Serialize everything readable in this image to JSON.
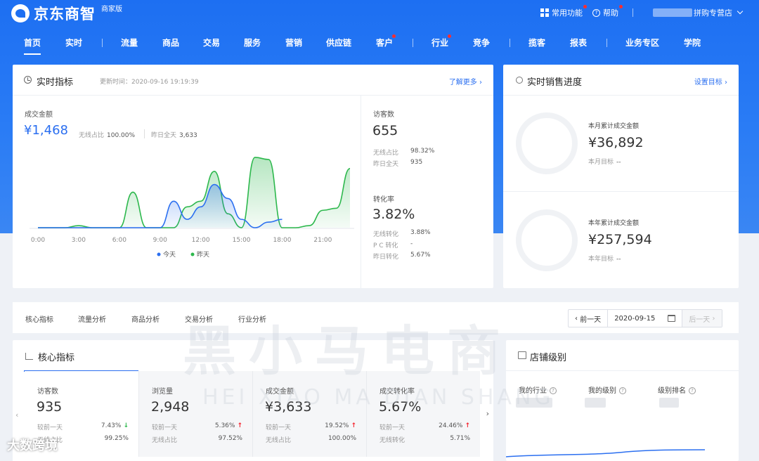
{
  "app": {
    "logo": "京东商智",
    "edition": "商家版"
  },
  "topbar": {
    "functions": "常用功能",
    "help": "帮助",
    "store": "拼购专营店"
  },
  "nav": [
    "首页",
    "实时",
    "流量",
    "商品",
    "交易",
    "服务",
    "营销",
    "供应链",
    "客户",
    "行业",
    "竞争",
    "揽客",
    "报表",
    "业务专区",
    "学院"
  ],
  "realtime": {
    "title": "实时指标",
    "update_time": "更新时间：2020-09-16 19:19:39",
    "more": "了解更多",
    "gmv_label": "成交金额",
    "gmv_value": "¥1,468",
    "wireless_label": "无线占比",
    "wireless_value": "100.00%",
    "yesterday_label": "昨日全天",
    "yesterday_value": "3,633",
    "visitors_label": "访客数",
    "visitors_value": "655",
    "v_wireless_label": "无线占比",
    "v_wireless_value": "98.32%",
    "v_yesterday_label": "昨日全天",
    "v_yesterday_value": "935",
    "conv_label": "转化率",
    "conv_value": "3.82%",
    "c_wireless_label": "无线转化",
    "c_wireless_value": "3.88%",
    "c_pc_label": "P C 转化",
    "c_pc_value": "-",
    "c_yesterday_label": "昨日转化",
    "c_yesterday_value": "5.67%"
  },
  "chart_data": {
    "type": "area",
    "x_ticks": [
      "0:00",
      "3:00",
      "6:00",
      "9:00",
      "12:00",
      "15:00",
      "18:00",
      "21:00"
    ],
    "x": [
      0,
      1,
      2,
      3,
      4,
      5,
      6,
      7,
      8,
      9,
      10,
      11,
      12,
      13,
      14,
      15,
      16,
      17,
      18,
      19,
      20,
      21,
      22,
      23
    ],
    "series": [
      {
        "name": "今天",
        "color": "#2b6ff0",
        "values": [
          0,
          0,
          0,
          0,
          0,
          0,
          0,
          0,
          0,
          0,
          38,
          12,
          30,
          62,
          42,
          12,
          0,
          8,
          12,
          null,
          null,
          null,
          null,
          null
        ]
      },
      {
        "name": "昨天",
        "color": "#2db84d",
        "values": [
          0,
          0,
          0,
          3,
          0,
          0,
          0,
          51,
          0,
          0,
          0,
          30,
          38,
          81,
          20,
          0,
          101,
          98,
          0,
          0,
          3,
          25,
          28,
          85
        ]
      }
    ],
    "legend": "bottom",
    "grid": false
  },
  "sales_progress": {
    "title": "实时销售进度",
    "set_goal": "设置目标",
    "month_label": "本月累计成交金额",
    "month_value": "¥36,892",
    "month_goal_label": "本月目标",
    "month_goal_value": "--",
    "year_label": "本年累计成交金额",
    "year_value": "¥257,594",
    "year_goal_label": "本年目标",
    "year_goal_value": "--"
  },
  "tabs": [
    "核心指标",
    "流量分析",
    "商品分析",
    "交易分析",
    "行业分析"
  ],
  "date_nav": {
    "prev": "前一天",
    "date": "2020-09-15",
    "next": "后一天"
  },
  "core": {
    "title": "核心指标",
    "cards": [
      {
        "label": "访客数",
        "value": "935",
        "r1_label": "较前一天",
        "r1_value": "7.43%",
        "r1_dir": "↓",
        "r2_label": "无线占比",
        "r2_value": "99.25%"
      },
      {
        "label": "浏览量",
        "value": "2,948",
        "r1_label": "较前一天",
        "r1_value": "5.36%",
        "r1_dir": "↑",
        "r2_label": "无线占比",
        "r2_value": "97.52%"
      },
      {
        "label": "成交金额",
        "value": "¥3,633",
        "r1_label": "较前一天",
        "r1_value": "19.52%",
        "r1_dir": "↑",
        "r2_label": "无线占比",
        "r2_value": "100.00%"
      },
      {
        "label": "成交转化率",
        "value": "5.67%",
        "r1_label": "较前一天",
        "r1_value": "24.46%",
        "r1_dir": "↑",
        "r2_label": "无线转化",
        "r2_value": "5.71%"
      }
    ]
  },
  "store_level": {
    "title": "店铺级别",
    "col1": "我的行业",
    "col2": "我的级别",
    "col3": "级别排名"
  },
  "watermark": {
    "cn": "黑小马电商",
    "en": "HEI XIAO MA DIAN SHANG",
    "corner": "大数跨境"
  }
}
